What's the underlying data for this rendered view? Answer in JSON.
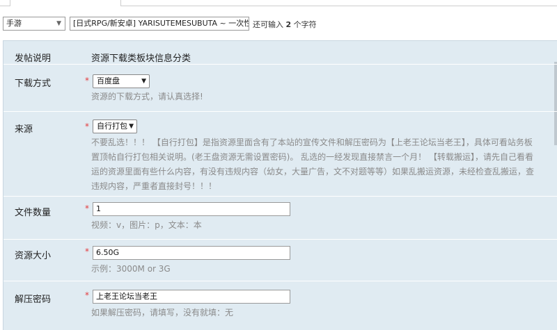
{
  "header": {
    "type_select_value": "手游",
    "title_value": "[日式RPG/新安卓] YARISUTEMESUBUTA ~ 一次性交易大",
    "char_hint_prefix": "还可输入",
    "char_hint_count": "2",
    "char_hint_suffix": "个字符"
  },
  "form": {
    "info": {
      "label": "发帖说明",
      "text": "资源下载类板块信息分类"
    },
    "download": {
      "label": "下载方式",
      "required": "*",
      "value": "百度盘",
      "hint": "资源的下载方式，请认真选择!"
    },
    "source": {
      "label": "来源",
      "required": "*",
      "value": "自行打包",
      "desc_lines": [
        "不要乱选！！！ 【自行打包】是指资源里面含有了本站的宣传文件和解压密码为【上老王论坛当老王】，具体可看站务板",
        "置顶帖自行打包相关说明。(老王盘资源无需设置密码)。 乱选的一经发现直接禁言一个月！ 【转载搬运】，请先自己看看",
        "运的资源里面有些什么内容，有没有违规内容（幼女，大量广告，文不对题等等）如果乱搬运资源，未经检查乱搬运，查",
        "违规内容，严重者直接封号！！！"
      ]
    },
    "file_count": {
      "label": "文件数量",
      "required": "*",
      "value": "1",
      "hint": "视频：v，图片：p，文本：本"
    },
    "size": {
      "label": "资源大小",
      "required": "*",
      "value": "6.50G",
      "hint": "示例：3000M or 3G"
    },
    "password": {
      "label": "解压密码",
      "required": "*",
      "value": "上老王论坛当老王",
      "hint": "如果解压密码，请填写，没有就填：无"
    }
  }
}
